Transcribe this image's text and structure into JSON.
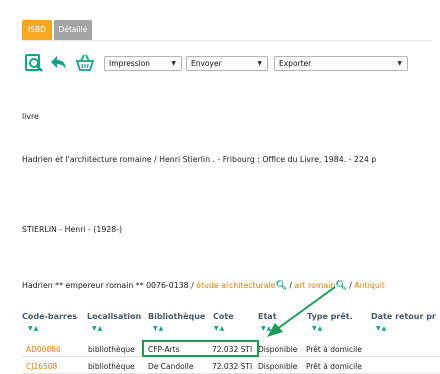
{
  "tabs": [
    {
      "label": "ISBD"
    },
    {
      "label": "Détaillé"
    }
  ],
  "toolbar": {
    "icons": [
      "search-document-icon",
      "back-arrow-icon",
      "basket-icon"
    ],
    "selects": [
      {
        "value": "Impression"
      },
      {
        "value": "Envoyer"
      },
      {
        "value": "Exporter"
      }
    ]
  },
  "record": {
    "type": "livre",
    "title_line": "Hadrien et l'architecture romaine  / Henri Stierlin . -   Fribourg : Office du Livre, 1984. - 224 p",
    "author": "STIERLIN - Henri - (1928-)",
    "subject_prefix": "Hadrien ** empereur romain ** 0076-0138 / ",
    "subject_link1": "étude architecturale",
    "subject_sep": " / ",
    "subject_link2": "art romain",
    "subject_link3": "Antiquit"
  },
  "table": {
    "headers": [
      "Code-barres",
      "Localisation",
      "Bibliothèque",
      "Cote",
      "Etat",
      "Type prêt.",
      "Date retour pr"
    ],
    "rows": [
      {
        "code": "AD00860",
        "localisation": "bibliothèque",
        "bibliotheque": "CFP-Arts",
        "cote": "72.032 STI",
        "etat": "Disponible",
        "type": "Prêt à domicile"
      },
      {
        "code": "CJ26508",
        "localisation": "bibliothèque",
        "bibliotheque": "De Candolle",
        "cote": "72.032 STI",
        "etat": "Disponible",
        "type": "Prêt à domicile"
      }
    ]
  },
  "colors": {
    "accent": "#f6a821",
    "link": "#e0820a",
    "sort": "#16a085",
    "highlight": "#1e9a57"
  }
}
